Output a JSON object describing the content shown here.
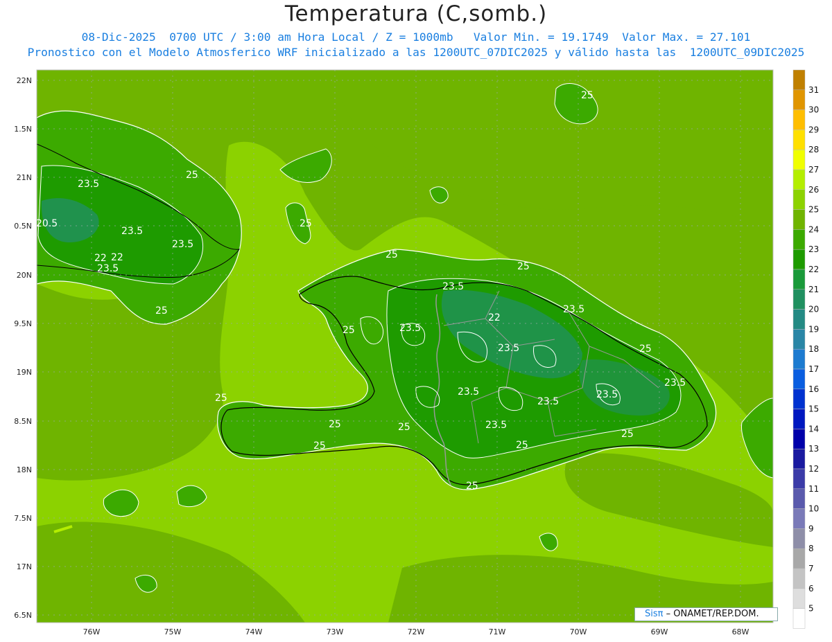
{
  "header": {
    "title": "Temperatura (C,somb.)",
    "line1": "08-Dic-2025  0700 UTC / 3:00 am Hora Local / Z = 1000mb   Valor Min. = 19.1749  Valor Max. = 27.101",
    "line2": "Pronostico con el Modelo Atmosferico WRF inicializado a las 1200UTC_07DIC2025 y válido hasta las  1200UTC_09DIC2025"
  },
  "axes": {
    "lat_labels": [
      "22N",
      "1.5N",
      "21N",
      "0.5N",
      "20N",
      "9.5N",
      "19N",
      "8.5N",
      "18N",
      "7.5N",
      "17N",
      "6.5N"
    ],
    "lon_labels": [
      "76W",
      "75W",
      "74W",
      "73W",
      "72W",
      "71W",
      "70W",
      "69W",
      "68W"
    ]
  },
  "colorbar": {
    "labels": [
      "31",
      "30",
      "29",
      "28",
      "27",
      "26",
      "25",
      "24",
      "23",
      "22",
      "21",
      "20",
      "19",
      "18",
      "17",
      "16",
      "15",
      "14",
      "13",
      "12",
      "11",
      "10",
      "9",
      "8",
      "7",
      "6",
      "5"
    ],
    "colors": [
      "#c08000",
      "#e09500",
      "#ffbe00",
      "#ffe000",
      "#f0ff00",
      "#b4ee00",
      "#8cd200",
      "#6fb400",
      "#3caa00",
      "#1e9b00",
      "#1a9a3a",
      "#209060",
      "#248a84",
      "#2a86a6",
      "#1d7bd0",
      "#0a5ee0",
      "#0032d0",
      "#0018c0",
      "#0000aa",
      "#1a1aa0",
      "#3b3ba8",
      "#5a5aad",
      "#7a7ab8",
      "#8e8ea8",
      "#a8a8a8",
      "#c4c4c4",
      "#dedede",
      "#ffffff"
    ]
  },
  "contour_labels": [
    "25",
    "23.5",
    "20.5",
    "23.5",
    "23.5",
    "22",
    "22",
    "23.5",
    "25",
    "25",
    "25",
    "25",
    "25",
    "23.5",
    "22",
    "23.5",
    "23.5",
    "25",
    "23.5",
    "25",
    "23.5",
    "23.5",
    "23.5",
    "23.5",
    "25",
    "23.5",
    "25",
    "25",
    "25",
    "25",
    "25",
    "25"
  ],
  "credit": {
    "brand": "Sisπ",
    "text": "– ONAMET/REP.DOM."
  },
  "colors": {
    "base_field": "#6fb400",
    "light_field": "#8cd200",
    "mid_field": "#3caa00",
    "dark_field": "#1e9b00",
    "title_blue": "#1a7fe0"
  }
}
